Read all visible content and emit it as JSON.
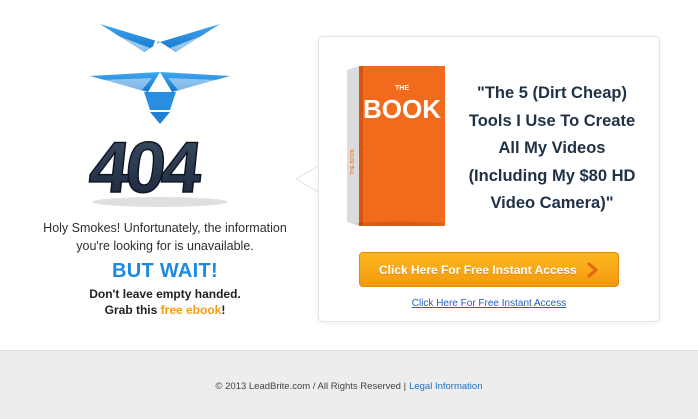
{
  "illustration": {
    "error_code": "404",
    "icon": "broken-bird-404-icon"
  },
  "apology": {
    "line1": "Holy Smokes! Unfortunately, the information",
    "line2": "you're looking for is unavailable."
  },
  "offer": {
    "but_wait": "BUT WAIT!",
    "dont_leave": "Don't leave empty handed.",
    "grab_prefix": "Grab this ",
    "grab_highlight": "free ebook",
    "grab_suffix": "!"
  },
  "book": {
    "small_label": "THE",
    "title": "BOOK",
    "spine_text": "THE BOOK"
  },
  "card": {
    "headline_lines": [
      "\"The 5 (Dirt Cheap)",
      "Tools I Use To Create",
      "All My Videos",
      "(Including My $80 HD",
      "Video Camera)\""
    ],
    "cta_button_label": "Click Here For Free Instant Access",
    "cta_link_label": "Click Here For Free Instant Access"
  },
  "footer": {
    "copyright": "© 2013 LeadBrite.com / All Rights Reserved |",
    "legal_link": "Legal Information"
  },
  "colors": {
    "accent_blue": "#1c8ae0",
    "cta_orange": "#f7a114",
    "book_orange": "#f26b1d",
    "headline_navy": "#203246"
  }
}
